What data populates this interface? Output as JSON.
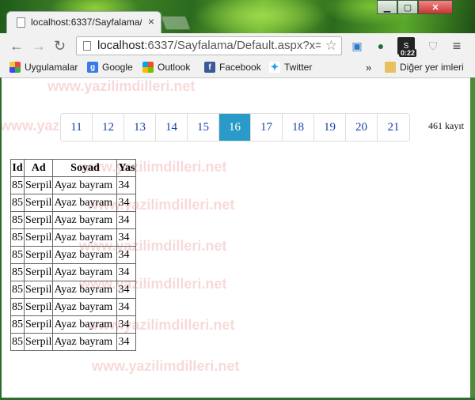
{
  "browser": {
    "tab_title": "localhost:6337/Sayfalama/",
    "tab_close": "×",
    "url_host": "localhost",
    "url_rest": ":6337/Sayfalama/Default.aspx?x=",
    "ext_badge": "0:22",
    "menu_glyph": "≡",
    "overflow_glyph": "»"
  },
  "bookmarks": {
    "apps": "Uygulamalar",
    "google": "Google",
    "outlook": "Outlook",
    "facebook": "Facebook",
    "twitter": "Twitter",
    "other": "Diğer yer imleri"
  },
  "watermark": "www.yazilimdilleri.net",
  "pager": {
    "pages": [
      "11",
      "12",
      "13",
      "14",
      "15",
      "16",
      "17",
      "18",
      "19",
      "20",
      "21"
    ],
    "active_page": "16"
  },
  "record_count": "461 kayıt",
  "table": {
    "headers": [
      "Id",
      "Ad",
      "Soyad",
      "Yas"
    ],
    "rows": [
      [
        "85",
        "Serpil",
        "Ayaz bayram",
        "34"
      ],
      [
        "85",
        "Serpil",
        "Ayaz bayram",
        "34"
      ],
      [
        "85",
        "Serpil",
        "Ayaz bayram",
        "34"
      ],
      [
        "85",
        "Serpil",
        "Ayaz bayram",
        "34"
      ],
      [
        "85",
        "Serpil",
        "Ayaz bayram",
        "34"
      ],
      [
        "85",
        "Serpil",
        "Ayaz bayram",
        "34"
      ],
      [
        "85",
        "Serpil",
        "Ayaz bayram",
        "34"
      ],
      [
        "85",
        "Serpil",
        "Ayaz bayram",
        "34"
      ],
      [
        "85",
        "Serpil",
        "Ayaz bayram",
        "34"
      ],
      [
        "85",
        "Serpil",
        "Ayaz bayram",
        "34"
      ]
    ]
  }
}
